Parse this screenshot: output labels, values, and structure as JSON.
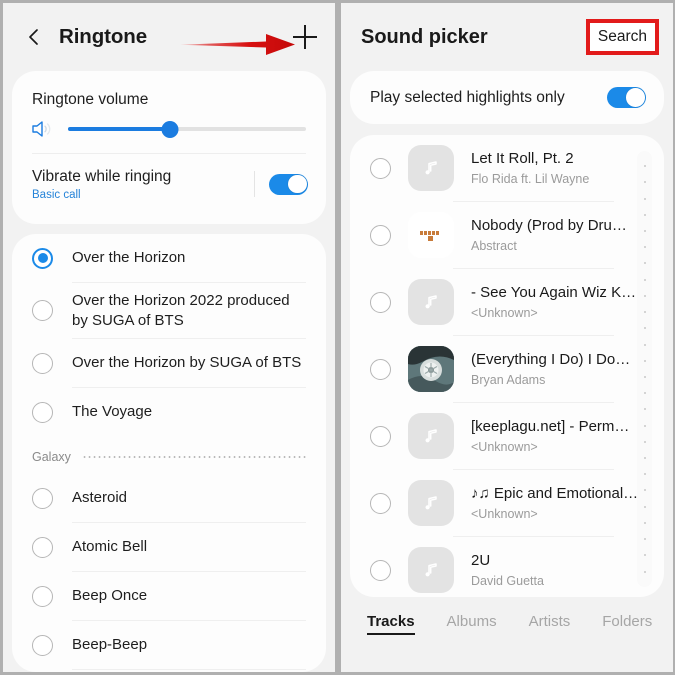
{
  "left_screen": {
    "appbar": {
      "back_icon": "chevron-left-icon",
      "title": "Ringtone",
      "add_icon": "plus-icon"
    },
    "volume_card": {
      "label": "Ringtone volume",
      "speaker_icon": "speaker-icon",
      "slider_value_percent": 43
    },
    "vibrate_row": {
      "title": "Vibrate while ringing",
      "subtitle": "Basic call",
      "toggle_on": true
    },
    "ringtones": [
      {
        "label": "Over the Horizon",
        "selected": true
      },
      {
        "label": "Over the Horizon 2022 produced by SUGA of BTS",
        "selected": false
      },
      {
        "label": "Over the Horizon by SUGA of BTS",
        "selected": false
      },
      {
        "label": "The Voyage",
        "selected": false
      }
    ],
    "section_header": "Galaxy",
    "galaxy_ringtones": [
      {
        "label": "Asteroid",
        "selected": false
      },
      {
        "label": "Atomic Bell",
        "selected": false
      },
      {
        "label": "Beep Once",
        "selected": false
      },
      {
        "label": "Beep-Beep",
        "selected": false
      }
    ]
  },
  "right_screen": {
    "appbar": {
      "title": "Sound picker",
      "search_label": "Search"
    },
    "highlights_row": {
      "label": "Play selected highlights only",
      "toggle_on": true
    },
    "tracks": [
      {
        "title": "Let It Roll, Pt. 2",
        "artist": "Flo Rida ft. Lil Wayne",
        "art": "music-note-placeholder",
        "selected": false
      },
      {
        "title": "Nobody (Prod by Dru…",
        "artist": "Abstract",
        "art": "album-art-nobody",
        "selected": false
      },
      {
        "title": "- See You Again Wiz K…",
        "artist": "<Unknown>",
        "art": "music-note-placeholder",
        "selected": false
      },
      {
        "title": "(Everything I Do) I Do…",
        "artist": "Bryan Adams",
        "art": "album-art-everything",
        "selected": false
      },
      {
        "title": "[keeplagu.net] - Perm…",
        "artist": "<Unknown>",
        "art": "music-note-placeholder",
        "selected": false
      },
      {
        "title": "♪♫ Epic and Emotional…",
        "artist": "<Unknown>",
        "art": "music-note-placeholder",
        "selected": false
      },
      {
        "title": "2U",
        "artist": "David Guetta",
        "art": "music-note-placeholder",
        "selected": false
      }
    ],
    "tabs": [
      {
        "label": "Tracks",
        "active": true
      },
      {
        "label": "Albums",
        "active": false
      },
      {
        "label": "Artists",
        "active": false
      },
      {
        "label": "Folders",
        "active": false
      }
    ]
  },
  "annotations": {
    "arrow_color": "#d81010",
    "highlight_box_color": "#e21b1b"
  },
  "colors": {
    "accent_blue": "#1b8ae8",
    "page_background": "#b0b0b0",
    "card_background": "#fdfdfd",
    "screen_background": "#f2f2f2"
  }
}
